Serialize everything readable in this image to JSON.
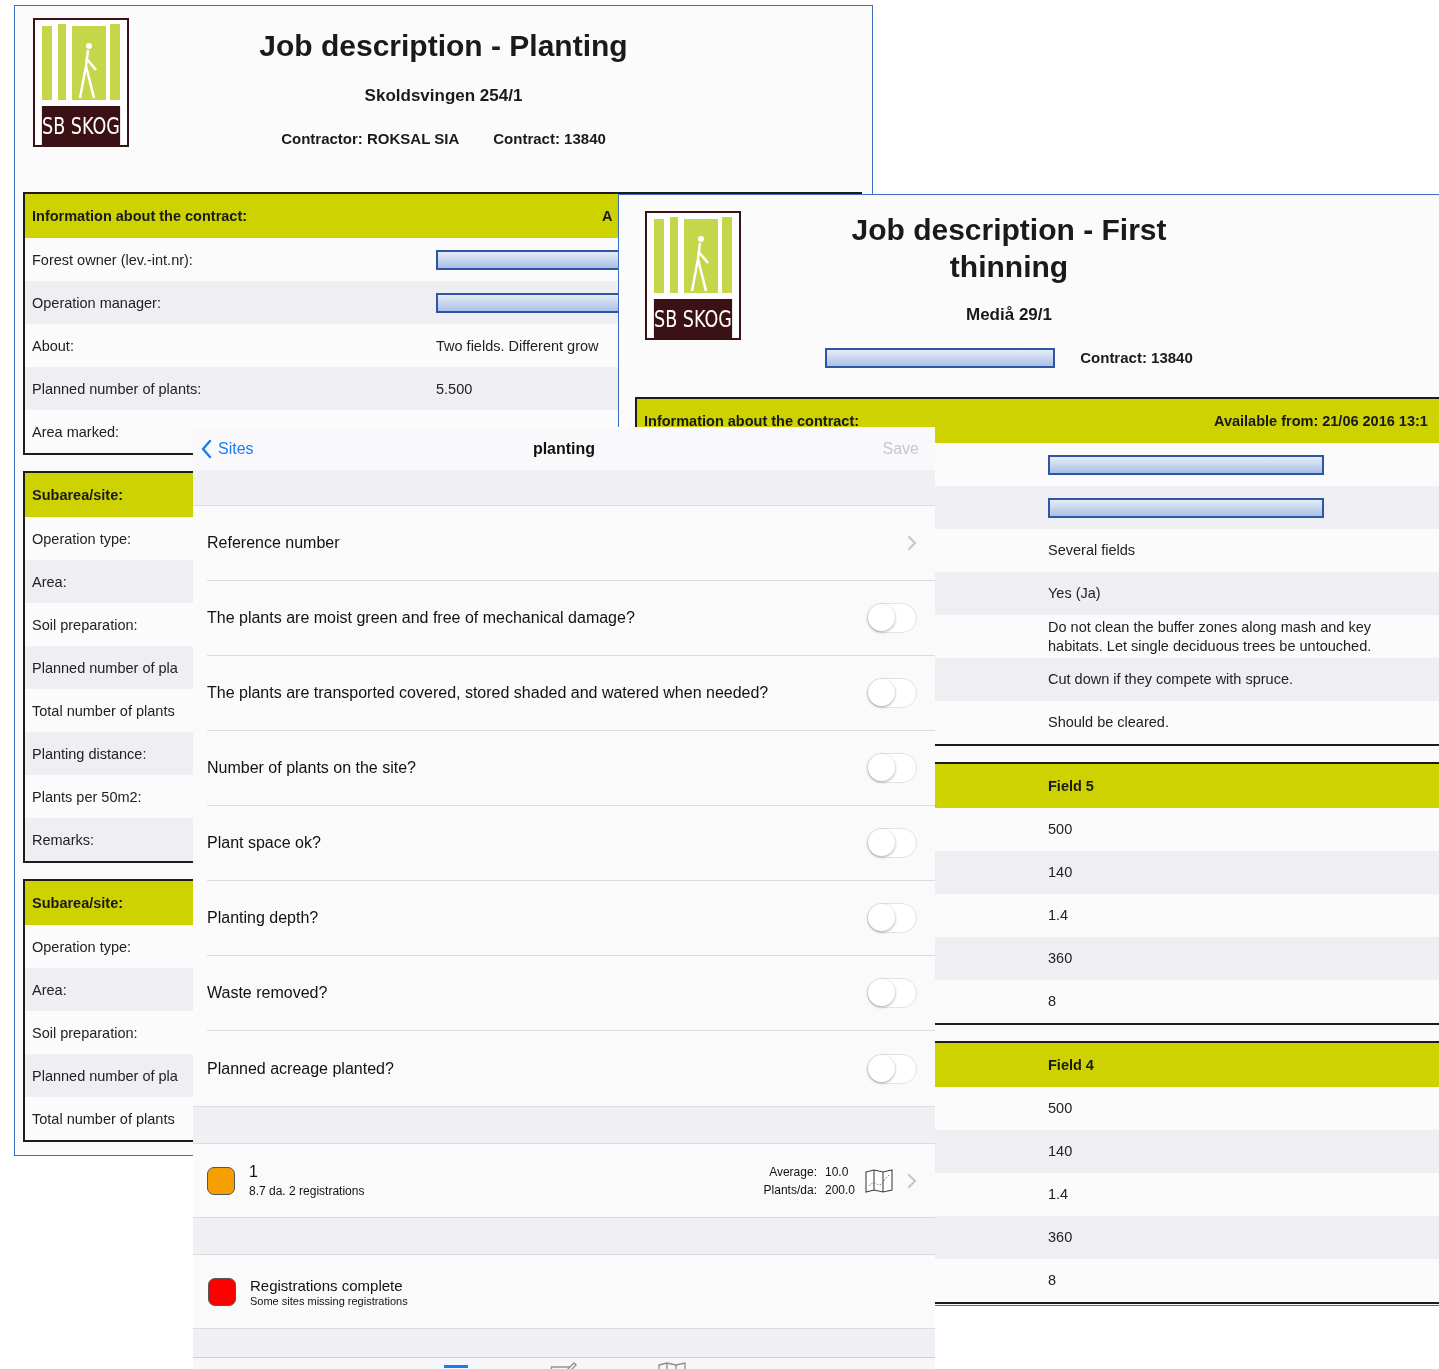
{
  "documents": [
    {
      "logo_text": "SB SKOG",
      "title": "Job description - Planting",
      "site": "Skoldsvingen 254/1",
      "header_fields": [
        {
          "kind": "text",
          "text": "Contractor: ROKSAL SIA"
        },
        {
          "kind": "text",
          "text": "Contract: 13840"
        }
      ],
      "tables": [
        {
          "header": {
            "kind": "section",
            "label": "Information about the contract:",
            "right": "A"
          },
          "rows": [
            {
              "kind": "redacted",
              "label": "Forest owner (lev.-int.nr):"
            },
            {
              "kind": "redacted",
              "label": "Operation manager:"
            },
            {
              "kind": "text",
              "label": "About:",
              "value": "Two fields. Different grow"
            },
            {
              "kind": "text",
              "label": "Planned number of plants:",
              "value": "5.500"
            },
            {
              "kind": "text",
              "label": "Area marked:"
            }
          ]
        },
        {
          "header": {
            "kind": "section",
            "label": "Subarea/site:"
          },
          "rows": [
            {
              "kind": "text",
              "label": "Operation type:"
            },
            {
              "kind": "text",
              "label": "Area:"
            },
            {
              "kind": "text",
              "label": "Soil preparation:"
            },
            {
              "kind": "text",
              "label": "Planned number of pla"
            },
            {
              "kind": "text",
              "label": "Total number of plants"
            },
            {
              "kind": "text",
              "label": "Planting distance:"
            },
            {
              "kind": "text",
              "label": "Plants per 50m2:"
            },
            {
              "kind": "text",
              "label": "Remarks:"
            }
          ]
        },
        {
          "header": {
            "kind": "section",
            "label": "Subarea/site:"
          },
          "rows": [
            {
              "kind": "text",
              "label": "Operation type:"
            },
            {
              "kind": "text",
              "label": "Area:"
            },
            {
              "kind": "text",
              "label": "Soil preparation:"
            },
            {
              "kind": "text",
              "label": "Planned number of pla"
            },
            {
              "kind": "text",
              "label": "Total number of plants"
            }
          ]
        }
      ]
    },
    {
      "logo_text": "SB SKOG",
      "title": "Job description - First thinning",
      "site": "Mediå 29/1",
      "header_fields": [
        {
          "kind": "redacted"
        },
        {
          "kind": "text",
          "text": "Contract: 13840"
        }
      ],
      "tables": [
        {
          "header": {
            "kind": "section",
            "label": "Information about the contract:",
            "right": "Available from: 21/06 2016 13:1"
          },
          "rows": [
            {
              "kind": "redacted"
            },
            {
              "kind": "redacted"
            },
            {
              "kind": "text",
              "value": "Several fields"
            },
            {
              "kind": "text",
              "value": "Yes (Ja)"
            },
            {
              "kind": "text",
              "value": "Do not clean the buffer zones along mash and key habitats. Let single deciduous trees be untouched."
            },
            {
              "kind": "text",
              "value": "Cut down if they compete with spruce."
            },
            {
              "kind": "text",
              "value": "Should be cleared."
            }
          ]
        },
        {
          "header": {
            "kind": "field",
            "label": "Field 5"
          },
          "rows": [
            {
              "kind": "text",
              "value": "500"
            },
            {
              "kind": "text",
              "value": "140"
            },
            {
              "kind": "text",
              "value": "1.4"
            },
            {
              "kind": "text",
              "value": "360"
            },
            {
              "kind": "text",
              "value": "8"
            }
          ]
        },
        {
          "header": {
            "kind": "field",
            "label": "Field 4"
          },
          "rows": [
            {
              "kind": "text",
              "value": "500"
            },
            {
              "kind": "text",
              "value": "140"
            },
            {
              "kind": "text",
              "value": "1.4"
            },
            {
              "kind": "text",
              "value": "360"
            },
            {
              "kind": "text",
              "value": "8"
            }
          ]
        }
      ]
    }
  ],
  "app": {
    "nav": {
      "back": "Sites",
      "title": "planting",
      "action": {
        "label": "Save",
        "disabled": true
      }
    },
    "sections": [
      {
        "rows": [
          {
            "kind": "link",
            "label": "Reference number"
          },
          {
            "kind": "toggle",
            "label": "The plants are moist green and free of mechanical damage?",
            "on": false
          },
          {
            "kind": "toggle",
            "label": "The plants are transported covered, stored shaded and watered when needed?",
            "on": false
          },
          {
            "kind": "toggle",
            "label": "Number of plants on the site?",
            "on": false
          },
          {
            "kind": "toggle",
            "label": "Plant space ok?",
            "on": false
          },
          {
            "kind": "toggle",
            "label": "Planting depth?",
            "on": false
          },
          {
            "kind": "toggle",
            "label": "Waste removed?",
            "on": false
          },
          {
            "kind": "toggle",
            "label": "Planned acreage planted?",
            "on": false
          }
        ]
      },
      {
        "rows": [
          {
            "kind": "site",
            "color": "#f59e00",
            "title": "1",
            "subtitle": "8.7 da. 2 registrations",
            "stats": [
              {
                "label": "Average:",
                "value": "10.0"
              },
              {
                "label": "Plants/da:",
                "value": "200.0"
              }
            ]
          }
        ]
      },
      {
        "rows": [
          {
            "kind": "status",
            "color": "#ff0000",
            "title": "Registrations complete",
            "subtitle": "Some sites missing registrations"
          }
        ]
      }
    ],
    "tabs": [
      {
        "kind": "list",
        "selected": true
      },
      {
        "kind": "edit",
        "selected": false
      },
      {
        "kind": "map",
        "selected": false
      }
    ]
  }
}
